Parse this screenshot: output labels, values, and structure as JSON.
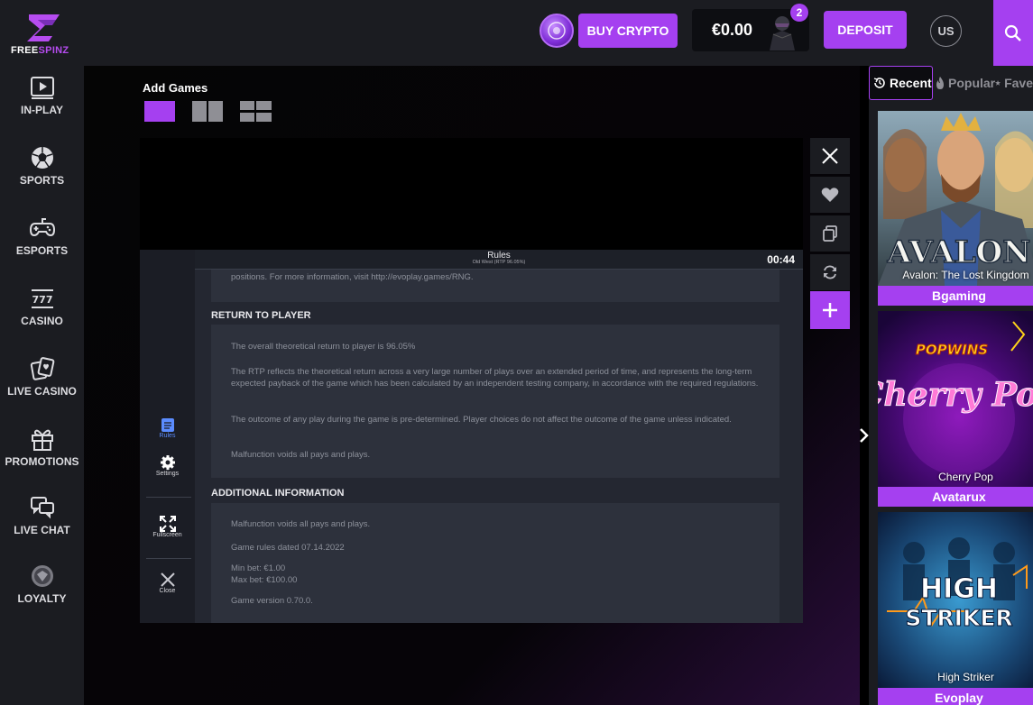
{
  "header": {
    "logo_text_a": "FREE",
    "logo_text_b": "SPINZ",
    "buy_crypto_label": "BUY CRYPTO",
    "balance": "€0.00",
    "notification_count": "2",
    "deposit_label": "DEPOSIT",
    "language": "US"
  },
  "sidebar": {
    "items": [
      {
        "label": "IN-PLAY",
        "icon": "play-icon"
      },
      {
        "label": "SPORTS",
        "icon": "soccer-ball-icon"
      },
      {
        "label": "ESPORTS",
        "icon": "gamepad-icon"
      },
      {
        "label": "CASINO",
        "icon": "slot-777-icon"
      },
      {
        "label": "LIVE CASINO",
        "icon": "cards-icon"
      },
      {
        "label": "PROMOTIONS",
        "icon": "gift-icon"
      },
      {
        "label": "LIVE CHAT",
        "icon": "chat-icon"
      },
      {
        "label": "LOYALTY",
        "icon": "loyalty-badge-icon"
      }
    ]
  },
  "main": {
    "add_games_label": "Add Games",
    "game": {
      "rules_title": "Rules",
      "rules_subtitle": "Old West (RTP 96.05%)",
      "timer": "00:44",
      "top_text": "positions. For more information, visit http://evoplay.games/RNG.",
      "section1_heading": "RETURN TO PLAYER",
      "section1_p1": "The overall theoretical return to player is 96.05%",
      "section1_p2": "The RTP reflects the theoretical return across a very large number of plays over an extended period of time, and represents the long-term expected payback of the game which has been calculated by an independent testing company, in accordance with the required regulations.",
      "section1_p3": "The outcome of any play during the game is pre-determined. Player choices do not affect the outcome of the game unless indicated.",
      "section1_p4": "Malfunction voids all pays and plays.",
      "section2_heading": "ADDITIONAL INFORMATION",
      "section2_p1": "Malfunction voids all pays and plays.",
      "section2_p2": "Game rules dated 07.14.2022",
      "section2_p3": "Min bet: €1.00",
      "section2_p4": "Max bet: €100.00",
      "section2_p5": "Game version 0.70.0.",
      "menu": {
        "rules": "Rules",
        "settings": "Settings",
        "fullscreen": "Fullscreen",
        "close": "Close"
      }
    }
  },
  "right_panel": {
    "tabs": {
      "recent": "Recent",
      "popular": "Popular",
      "favourites": "Fave"
    },
    "games": [
      {
        "title": "AVALON",
        "name": "Avalon: The Lost Kingdom",
        "provider": "Bgaming"
      },
      {
        "title": "Cherry Pop",
        "brand": "POPWINS",
        "name": "Cherry Pop",
        "provider": "Avatarux"
      },
      {
        "title": "HIGH STRIKER",
        "name": "High Striker",
        "provider": "Evoplay"
      }
    ]
  },
  "colors": {
    "accent": "#a540f0",
    "panel": "#1b1c21",
    "rules_bg": "#242731"
  }
}
